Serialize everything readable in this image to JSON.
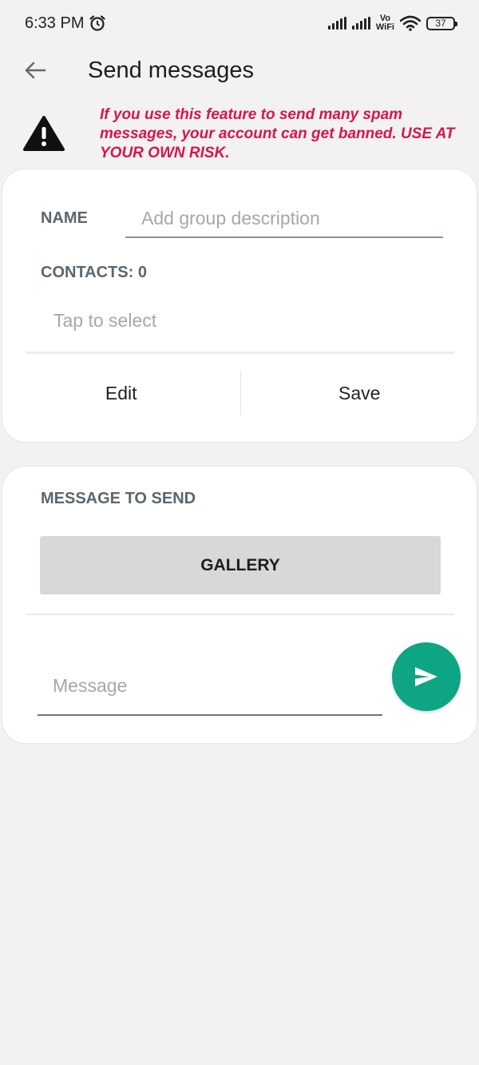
{
  "status_bar": {
    "time": "6:33 PM",
    "vo": "Vo",
    "wifi_label": "WiFi",
    "battery": "37"
  },
  "header": {
    "title": "Send messages"
  },
  "warning": {
    "text": "If you use this feature to send many spam messages, your account can get banned. USE AT YOUR OWN RISK.",
    "color": "#d8154a"
  },
  "group_card": {
    "name_label": "NAME",
    "name_value": "",
    "name_placeholder": "Add group description",
    "contacts_label": "CONTACTS: 0",
    "tap_to_select": "Tap to select",
    "edit_label": "Edit",
    "save_label": "Save"
  },
  "message_card": {
    "label": "MESSAGE TO SEND",
    "gallery_label": "GALLERY",
    "message_value": "",
    "message_placeholder": "Message"
  },
  "colors": {
    "accent": "#0ea582",
    "label": "#5a6670",
    "background": "#f2f2f2"
  }
}
